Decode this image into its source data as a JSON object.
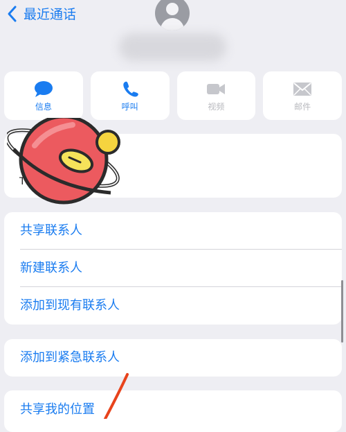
{
  "nav": {
    "back_label": "最近通话"
  },
  "actions": [
    {
      "label": "信息",
      "icon": "message-icon",
      "enabled": true
    },
    {
      "label": "呼叫",
      "icon": "phone-icon",
      "enabled": true
    },
    {
      "label": "视频",
      "icon": "video-icon",
      "enabled": false
    },
    {
      "label": "邮件",
      "icon": "mail-icon",
      "enabled": false
    }
  ],
  "notes": {
    "label": "T"
  },
  "menu": {
    "share_contact": "共享联系人",
    "new_contact": "新建联系人",
    "add_existing": "添加到现有联系人",
    "add_emergency": "添加到紧急联系人",
    "share_location": "共享我的位置"
  },
  "colors": {
    "accent": "#1a7cf0",
    "disabled": "#b8b9be",
    "background": "#eeeef3",
    "annotation_arrow": "#e8431c"
  }
}
